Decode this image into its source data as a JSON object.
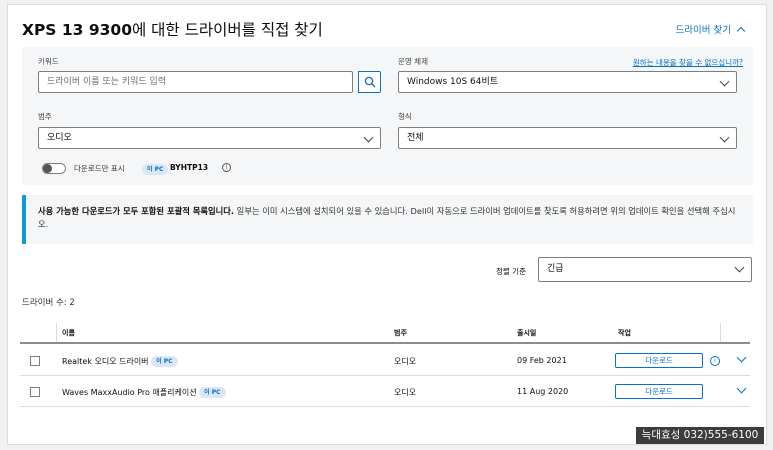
{
  "header": {
    "model": "XPS 13 9300",
    "title_rest": "에 대한 드라이버를 직접 찾기",
    "find_driver_link": "드라이버 찾기"
  },
  "filters": {
    "keyword_label": "키워드",
    "keyword_placeholder": "드라이버 이름 또는 키워드 입력",
    "os_label": "운영 체제",
    "help_link": "원하는 내용을 찾을 수 없으십니까?",
    "os_value": "Windows 10S 64비트",
    "category_label": "범주",
    "category_value": "오디오",
    "format_label": "형식",
    "format_value": "전체",
    "toggle_label": "다운로드만 표시",
    "pc_badge": "이 PC",
    "service_tag": "BYHTP13"
  },
  "notice": {
    "bold": "사용 가능한 다운로드가 모두 포함된 포괄적 목록입니다.",
    "text": " 일부는 이미 시스템에 설치되어 있을 수 있습니다. Dell이 자동으로 드라이버 업데이트를 찾도록 허용하려면 위의 업데이트 확인을 선택해 주십시오."
  },
  "sort": {
    "label": "정렬 기준",
    "value": "긴급"
  },
  "driver_count": "드라이버 수: 2",
  "table": {
    "headers": {
      "name": "이름",
      "category": "범주",
      "release": "출시일",
      "action": "작업"
    },
    "rows": [
      {
        "name": "Realtek 오디오 드라이버",
        "badge": "이 PC",
        "category": "오디오",
        "date": "09 Feb 2021",
        "button": "다운로드",
        "has_info": true
      },
      {
        "name": "Waves MaxxAudio Pro 애플리케이션",
        "badge": "이 PC",
        "category": "오디오",
        "date": "11 Aug 2020",
        "button": "다운로드",
        "has_info": false
      }
    ]
  },
  "contact_tag": "늑대효성 032)555-6100",
  "colors": {
    "accent": "#0672cb",
    "notice_bar": "#0d9bd8",
    "panel": "#f5f6f7"
  },
  "icons": [
    "search-icon",
    "chevron-down-icon",
    "chevron-up-icon",
    "info-icon",
    "toggle-switch"
  ]
}
